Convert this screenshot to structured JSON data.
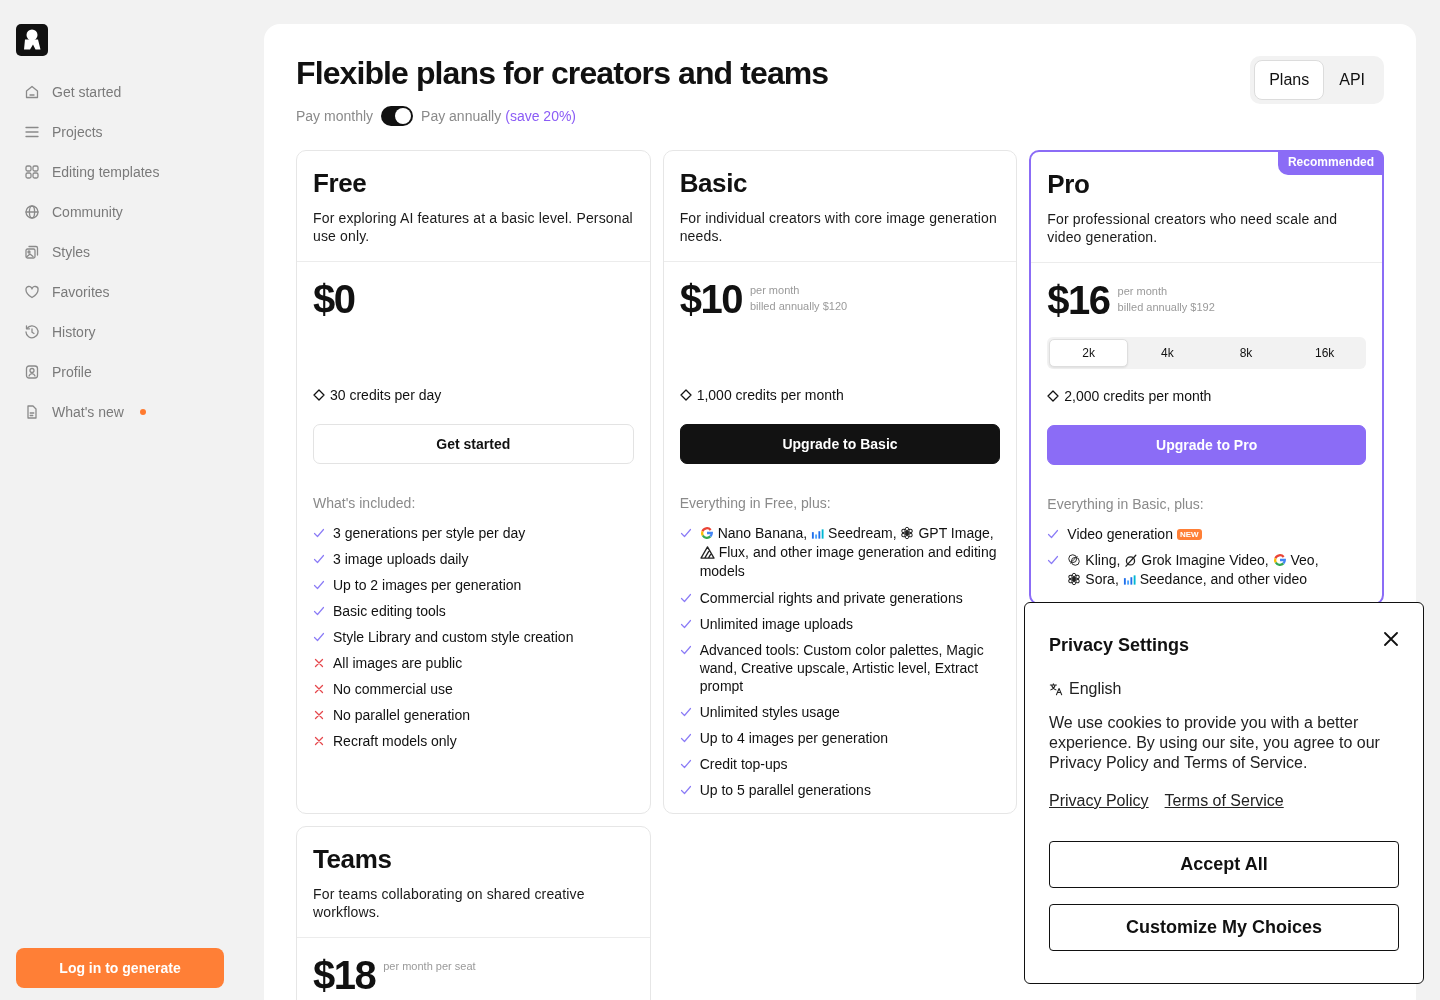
{
  "sidebar": {
    "items": [
      {
        "label": "Get started",
        "selected": false,
        "unread": false
      },
      {
        "label": "Projects",
        "selected": false,
        "unread": false
      },
      {
        "label": "Editing templates",
        "selected": false,
        "unread": false
      },
      {
        "label": "Community",
        "selected": false,
        "unread": false
      },
      {
        "label": "Styles",
        "selected": false,
        "unread": false
      },
      {
        "label": "Favorites",
        "selected": false,
        "unread": false
      },
      {
        "label": "History",
        "selected": false,
        "unread": false
      },
      {
        "label": "Profile",
        "selected": false,
        "unread": false
      },
      {
        "label": "What's new",
        "selected": false,
        "unread": true
      }
    ],
    "login_button": "Log in to generate"
  },
  "header": {
    "title": "Flexible plans for creators and teams",
    "billing": {
      "monthly_label": "Pay monthly",
      "on": true,
      "annual_label": "Pay annually",
      "savings": "(save 20%)"
    },
    "view_tabs": [
      {
        "label": "Plans",
        "selected": true
      },
      {
        "label": "API",
        "selected": false
      }
    ]
  },
  "plans": [
    {
      "name": "Free",
      "recommended": false,
      "description": "For exploring AI features at a basic level. Personal use only.",
      "price": "$0",
      "credits": "30 credits per day",
      "button": {
        "label": "Get started",
        "kind": "outline"
      },
      "features_heading": "What's included:",
      "features": [
        {
          "included": true,
          "text": "3 generations per style per day"
        },
        {
          "included": true,
          "text": "3 image uploads daily"
        },
        {
          "included": true,
          "text": "Up to 2 images per generation"
        },
        {
          "included": true,
          "text": "Basic editing tools"
        },
        {
          "included": true,
          "text": "Style Library and custom style creation"
        },
        {
          "included": false,
          "text": "All images are public"
        },
        {
          "included": false,
          "text": "No commercial use"
        },
        {
          "included": false,
          "text": "No parallel generation"
        },
        {
          "included": false,
          "text": "Recraft models only"
        }
      ]
    },
    {
      "name": "Basic",
      "recommended": false,
      "description": "For individual creators with core image generation needs.",
      "price": "$10",
      "price_notes": [
        "per month",
        "billed annually $120"
      ],
      "credits": "1,000 credits per month",
      "button": {
        "label": "Upgrade to Basic",
        "kind": "dark"
      },
      "features_heading": "Everything in Free, plus:",
      "features": [
        {
          "included": true,
          "parts": [
            {
              "kind": "gletter",
              "text": "Nano Banana,"
            },
            {
              "kind": "bars",
              "text": "Seedream,"
            },
            {
              "kind": "knot",
              "text": "GPT Image,"
            },
            {
              "kind": "peaks",
              "text": "Flux,"
            },
            {
              "kind": "text",
              "text": "and other image generation and editing models"
            }
          ]
        },
        {
          "included": true,
          "text": "Commercial rights and private generations"
        },
        {
          "included": true,
          "text": "Unlimited image uploads"
        },
        {
          "included": true,
          "text": "Advanced tools: Custom color palettes, Magic wand, Creative upscale, Artistic level, Extract prompt"
        },
        {
          "included": true,
          "text": "Unlimited styles usage"
        },
        {
          "included": true,
          "text": "Up to 4 images per generation"
        },
        {
          "included": true,
          "text": "Credit top-ups"
        },
        {
          "included": true,
          "text": "Up to 5 parallel generations"
        }
      ]
    },
    {
      "name": "Pro",
      "recommended": true,
      "badge": "Recommended",
      "description": "For professional creators who need scale and video generation.",
      "price": "$16",
      "price_notes": [
        "per month",
        "billed annually $192"
      ],
      "resolution_options": [
        {
          "label": "2k",
          "selected": true
        },
        {
          "label": "4k",
          "selected": false
        },
        {
          "label": "8k",
          "selected": false
        },
        {
          "label": "16k",
          "selected": false
        }
      ],
      "credits": "2,000 credits per month",
      "button": {
        "label": "Upgrade to Pro",
        "kind": "accent"
      },
      "features_heading": "Everything in Basic, plus:",
      "features": [
        {
          "included": true,
          "text": "Video generation",
          "tag": "NEW"
        },
        {
          "included": true,
          "parts": [
            {
              "kind": "loops",
              "text": "Kling,"
            },
            {
              "kind": "slash",
              "text": "Grok Imagine Video,"
            },
            {
              "kind": "gletter",
              "text": "Veo,"
            },
            {
              "kind": "knot",
              "text": "Sora,"
            },
            {
              "kind": "bars",
              "text": "Seedance,"
            },
            {
              "kind": "text",
              "text": "and other video"
            }
          ]
        }
      ]
    },
    {
      "name": "Teams",
      "recommended": false,
      "description": "For teams collaborating on shared creative workflows.",
      "price": "$18",
      "price_notes": [
        "per month per seat"
      ]
    }
  ],
  "privacy_dialog": {
    "title": "Privacy Settings",
    "language": "English",
    "message": "We use cookies to provide you with a better experience. By using our site, you agree to our Privacy Policy and Terms of Service.",
    "links": [
      "Privacy Policy",
      "Terms of Service"
    ],
    "buttons": [
      "Accept All",
      "Customize My Choices"
    ]
  }
}
